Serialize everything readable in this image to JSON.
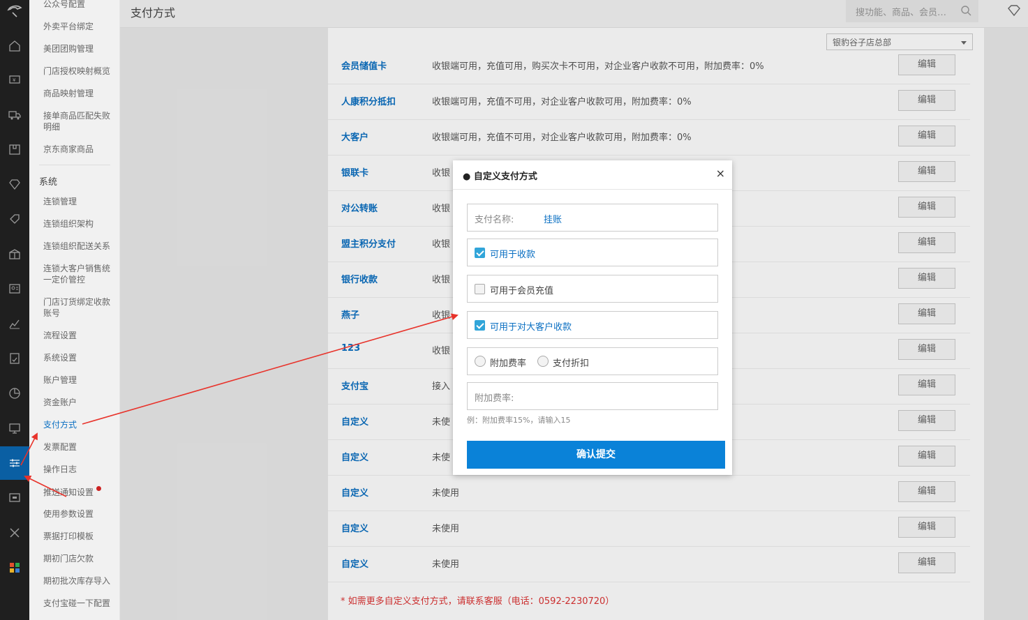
{
  "header": {
    "title": "支付方式",
    "search_placeholder": "搜功能、商品、会员…"
  },
  "subnav": {
    "items_top": [
      "公众号配置",
      "外卖平台绑定",
      "美团团购管理",
      "门店授权映射概览",
      "商品映射管理",
      "接单商品匹配失败明细",
      "京东商家商品"
    ],
    "section_title": "系统",
    "items": [
      "连锁管理",
      "连锁组织架构",
      "连锁组织配送关系",
      "连锁大客户销售统一定价管控",
      "门店订货绑定收款账号",
      "流程设置",
      "系统设置",
      "账户管理",
      "资金账户",
      "支付方式",
      "发票配置",
      "操作日志",
      "推送通知设置",
      "使用参数设置",
      "票据打印模板",
      "期初门店欠款",
      "期初批次库存导入",
      "支付宝碰一下配置"
    ],
    "active_item": "支付方式"
  },
  "store_select": {
    "value": "银豹谷子店总部"
  },
  "payment_rows": [
    {
      "name": "会员储值卡",
      "desc": "收银端可用，充值可用，购买次卡不可用，对企业客户收款不可用，附加费率：0%",
      "edit": "编辑"
    },
    {
      "name": "人康积分抵扣",
      "desc": "收银端可用，充值不可用，对企业客户收款可用，附加费率：0%",
      "edit": "编辑"
    },
    {
      "name": "大客户",
      "desc": "收银端可用，充值不可用，对企业客户收款可用，附加费率：0%",
      "edit": "编辑"
    },
    {
      "name": "银联卡",
      "desc": "收银",
      "edit": "编辑"
    },
    {
      "name": "对公转账",
      "desc": "收银",
      "edit": "编辑"
    },
    {
      "name": "盟主积分支付",
      "desc": "收银",
      "edit": "编辑"
    },
    {
      "name": "银行收款",
      "desc": "收银",
      "edit": "编辑"
    },
    {
      "name": "燕子",
      "desc": "收银",
      "edit": "编辑"
    },
    {
      "name": "123",
      "desc": "收银",
      "edit": "编辑"
    },
    {
      "name": "支付宝",
      "desc": "接入",
      "edit": "编辑"
    },
    {
      "name": "自定义",
      "desc": "未使",
      "edit": "编辑"
    },
    {
      "name": "自定义",
      "desc": "未使",
      "edit": "编辑"
    },
    {
      "name": "自定义",
      "desc": "未使用",
      "edit": "编辑"
    },
    {
      "name": "自定义",
      "desc": "未使用",
      "edit": "编辑"
    },
    {
      "name": "自定义",
      "desc": "未使用",
      "edit": "编辑"
    }
  ],
  "footnote": "* 如需更多自定义支付方式，请联系客服（电话：0592-2230720）",
  "modal": {
    "title": "● 自定义支付方式",
    "close": "×",
    "name_label": "支付名称:",
    "name_value": "挂账",
    "cb_receive": "可用于收款",
    "cb_receive_checked": true,
    "cb_recharge": "可用于会员充值",
    "cb_recharge_checked": false,
    "cb_bigclient": "可用于对大客户收款",
    "cb_bigclient_checked": true,
    "radio_fee": "附加费率",
    "radio_discount": "支付折扣",
    "fee_placeholder": "附加费率:",
    "hint": "例：附加费率15%，请输入15",
    "submit": "确认提交"
  },
  "colors": {
    "accent": "#0a6fc2",
    "rail_bg": "#1f1f1f",
    "rail_active": "#0a5fa3",
    "submit_bg": "#0a82d8",
    "arrow": "#e8332b"
  }
}
